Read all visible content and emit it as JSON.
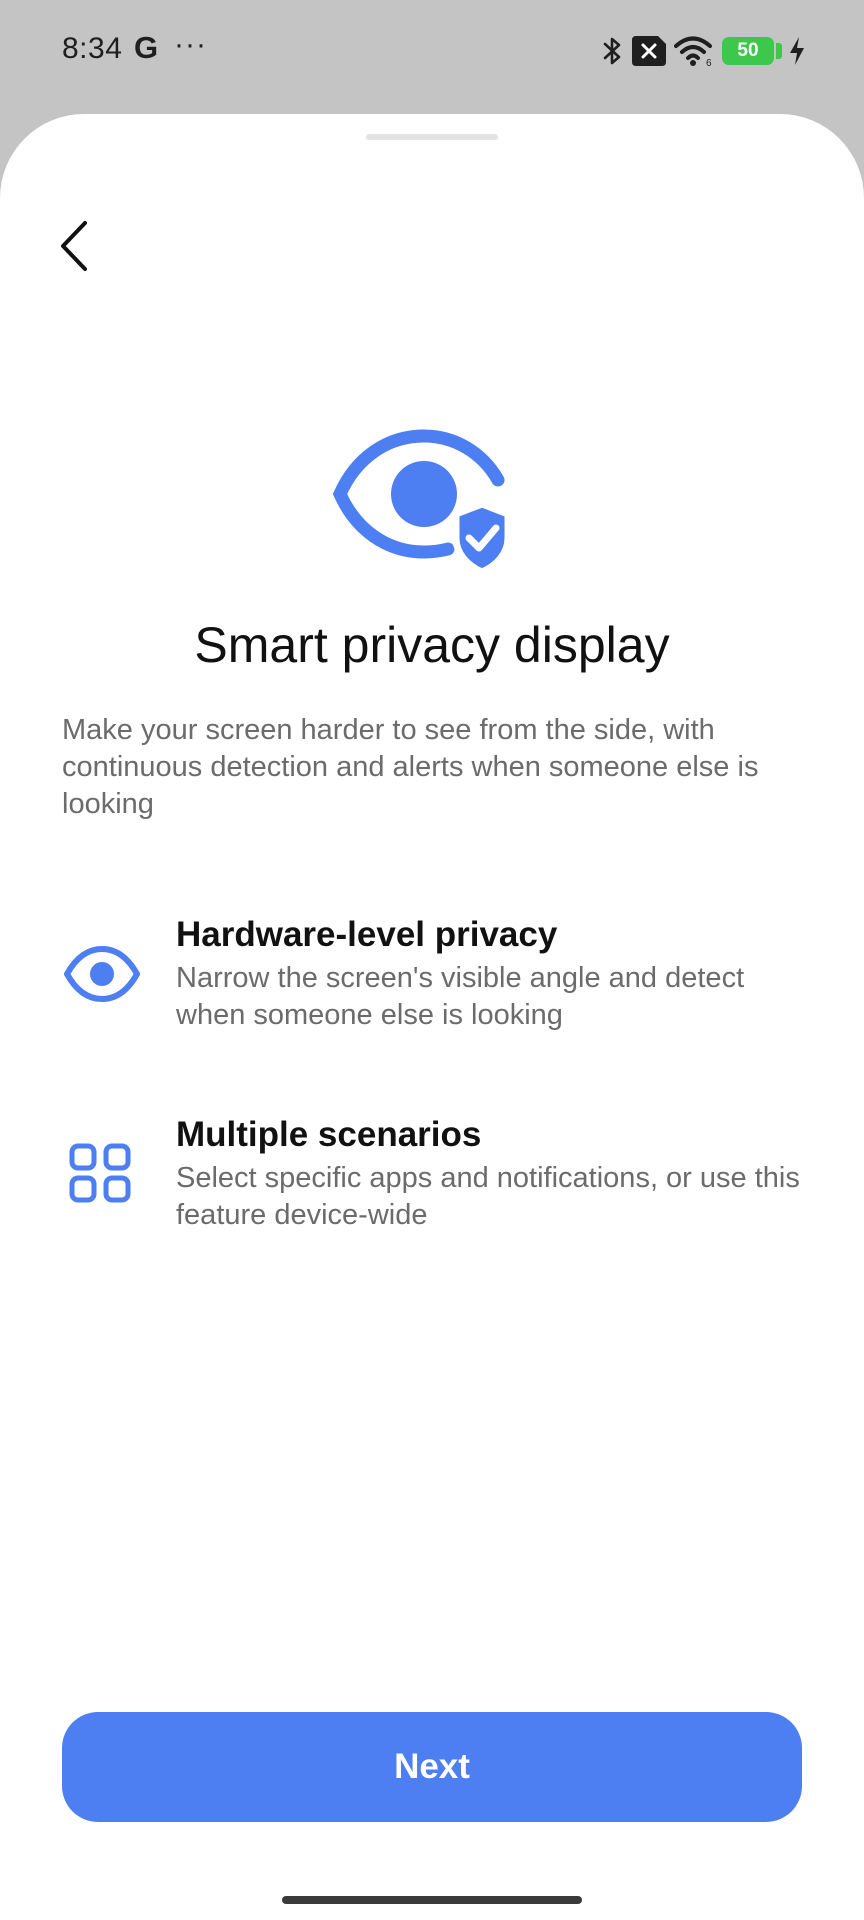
{
  "status_bar": {
    "time": "8:34",
    "g_label": "G",
    "more_label": "···",
    "battery_level": "50",
    "icons": [
      "bluetooth-icon",
      "sim-off-icon",
      "wifi-icon",
      "battery-icon",
      "charging-icon"
    ]
  },
  "header": {
    "back_icon": "chevron-left-icon"
  },
  "hero": {
    "icon": "eye-shield-icon",
    "accent_color": "#4d7ef2"
  },
  "page": {
    "title": "Smart privacy display",
    "description": "Make your screen harder to see from the side, with continuous detection and alerts when someone else is looking"
  },
  "features": [
    {
      "icon": "eye-icon",
      "title": "Hardware-level privacy",
      "description": "Narrow the screen's visible angle and detect when someone else is looking"
    },
    {
      "icon": "grid-icon",
      "title": "Multiple scenarios",
      "description": "Select specific apps and notifications, or use this feature device-wide"
    }
  ],
  "footer": {
    "next_label": "Next",
    "button_color": "#4d7ef2"
  }
}
